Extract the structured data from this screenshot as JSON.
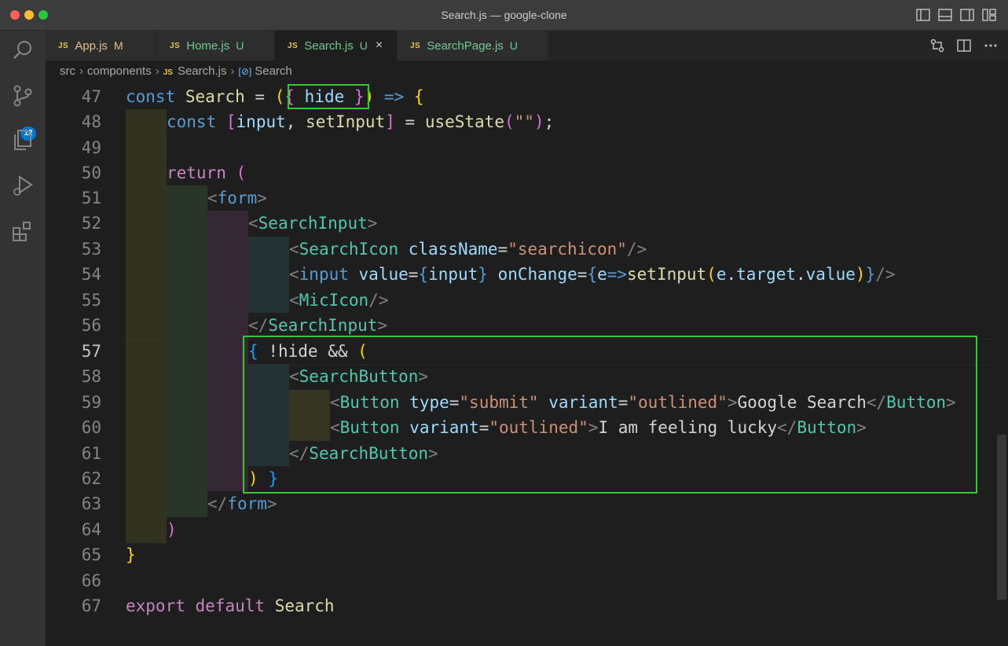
{
  "window": {
    "title": "Search.js — google-clone"
  },
  "activity_bar": {
    "scm_badge": "12"
  },
  "tabs": [
    {
      "icon": "JS",
      "name": "App.js",
      "status": "M"
    },
    {
      "icon": "JS",
      "name": "Home.js",
      "status": "U"
    },
    {
      "icon": "JS",
      "name": "Search.js",
      "status": "U",
      "close": "×"
    },
    {
      "icon": "JS",
      "name": "SearchPage.js",
      "status": "U"
    }
  ],
  "breadcrumb": {
    "part1": "src",
    "part2": "components",
    "file_icon": "JS",
    "file": "Search.js",
    "symbol": "Search"
  },
  "editor": {
    "current_line": "57",
    "line_numbers": [
      "47",
      "48",
      "49",
      "50",
      "51",
      "52",
      "53",
      "54",
      "55",
      "56",
      "57",
      "58",
      "59",
      "60",
      "61",
      "62",
      "63",
      "64",
      "65",
      "66",
      "67"
    ],
    "code": {
      "l47": [
        "const",
        "Search",
        "=",
        "(",
        "{",
        "hide",
        "}",
        ")",
        "=>",
        "{"
      ],
      "l48": [
        "const",
        "[",
        "input",
        ", ",
        "setInput",
        "]",
        "=",
        "useState",
        "(",
        "\"\"",
        ")",
        ";"
      ],
      "l50": [
        "return",
        "("
      ],
      "l51": [
        "<",
        "form",
        ">"
      ],
      "l52": [
        "<",
        "SearchInput",
        ">"
      ],
      "l53": [
        "<",
        "SearchIcon",
        "className",
        "=",
        "\"searchicon\"",
        "/>"
      ],
      "l54": [
        "<",
        "input",
        "value",
        "=",
        "{",
        "input",
        "}",
        "onChange",
        "=",
        "{",
        "e",
        "=>",
        "setInput",
        "(",
        "e",
        ".",
        "target",
        ".",
        "value",
        ")",
        "}",
        "/>"
      ],
      "l55": [
        "<",
        "MicIcon",
        "/>"
      ],
      "l56": [
        "</",
        "SearchInput",
        ">"
      ],
      "l57": [
        "{",
        "!hide",
        "&&",
        "("
      ],
      "l58": [
        "<",
        "SearchButton",
        ">"
      ],
      "l59": [
        "<",
        "Button",
        "type",
        "=",
        "\"submit\"",
        "variant",
        "=",
        "\"outlined\"",
        ">",
        "Google Search",
        "</",
        "Button",
        ">"
      ],
      "l60": [
        "<",
        "Button",
        "variant",
        "=",
        "\"outlined\"",
        ">",
        "I am feeling lucky",
        "</",
        "Button",
        ">"
      ],
      "l61": [
        "</",
        "SearchButton",
        ">"
      ],
      "l62": [
        ")",
        "}"
      ],
      "l63": [
        "</",
        "form",
        ">"
      ],
      "l64": [
        ")"
      ],
      "l65": [
        "}"
      ],
      "l67": [
        "export",
        "default",
        "Search"
      ]
    }
  }
}
